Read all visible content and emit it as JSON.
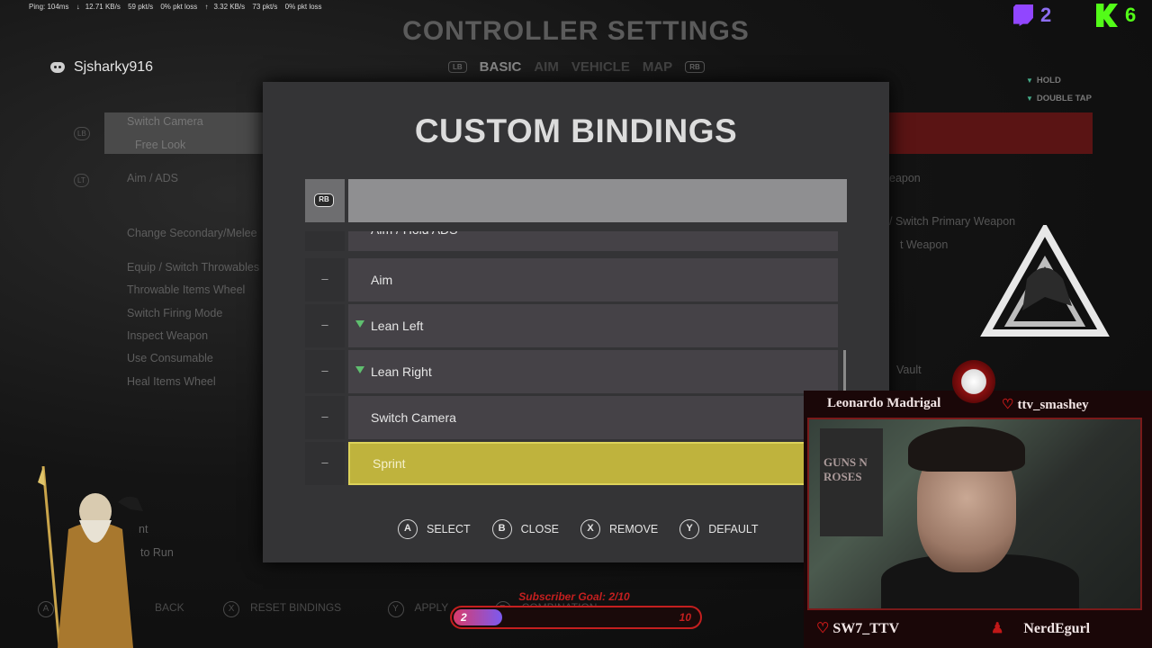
{
  "stats": {
    "ping": "Ping: 104ms",
    "down": "12.71 KB/s",
    "down_pkts": "59 pkt/s",
    "down_loss": "0% pkt loss",
    "up": "3.32 KB/s",
    "up_pkts": "73 pkt/s",
    "up_loss": "0% pkt loss"
  },
  "background_menu": {
    "title": "CONTROLLER SETTINGS",
    "tab_left": "LB",
    "tabs": [
      "BASIC",
      "AIM",
      "VEHICLE",
      "MAP"
    ],
    "tab_right": "RB",
    "legend": [
      "HOLD",
      "DOUBLE TAP"
    ],
    "left_badges": [
      "LB",
      "LT"
    ],
    "left_items": [
      "Switch Camera",
      "Free Look",
      "Aim / ADS",
      "Change Secondary/Melee",
      "Equip / Switch Throwables",
      "Throwable Items Wheel",
      "Switch Firing Mode",
      "Inspect Weapon",
      "Use Consumable",
      "Heal Items Wheel",
      "nt",
      "to Run"
    ],
    "right_items": [
      "eapon",
      "/ Switch Primary Weapon",
      "t Weapon",
      "Vault"
    ],
    "bottom": [
      {
        "btn": "A",
        "label": "BACK"
      },
      {
        "btn": "X",
        "label": "RESET BINDINGS"
      },
      {
        "btn": "Y",
        "label": "APPLY"
      },
      {
        "btn": "R",
        "label": "COMBINATION"
      }
    ]
  },
  "discord_user": "Sjsharky916",
  "modal": {
    "title": "CUSTOM BINDINGS",
    "tab_rb": "RB",
    "dash": "–",
    "bindings": [
      {
        "label": "Aim / Hold ADS",
        "check": false,
        "selected": false
      },
      {
        "label": "Aim",
        "check": false,
        "selected": false
      },
      {
        "label": "Lean Left",
        "check": true,
        "selected": false
      },
      {
        "label": "Lean Right",
        "check": true,
        "selected": false
      },
      {
        "label": "Switch Camera",
        "check": false,
        "selected": false
      },
      {
        "label": "Sprint",
        "check": false,
        "selected": true
      }
    ],
    "footer": [
      {
        "btn": "A",
        "label": "SELECT"
      },
      {
        "btn": "B",
        "label": "CLOSE"
      },
      {
        "btn": "X",
        "label": "REMOVE"
      },
      {
        "btn": "Y",
        "label": "DEFAULT"
      }
    ]
  },
  "overlay": {
    "twitch_count": "2",
    "kick_count": "6",
    "cam_name_left": "Leonardo Madrigal",
    "cam_name_right": "ttv_smashey",
    "cam_bottom_left": "SW7_TTV",
    "cam_bottom_right": "NerdEgurl",
    "poster_text": "GUNS N ROSES",
    "subscriber_goal": {
      "title": "Subscriber Goal: 2/10",
      "current": "2",
      "target": "10",
      "progress": 0.2
    },
    "colors": {
      "twitch": "#9146ff",
      "kick": "#53fc18",
      "accent_red": "#c41f1f",
      "selected_yellow": "#bfb33d"
    }
  }
}
